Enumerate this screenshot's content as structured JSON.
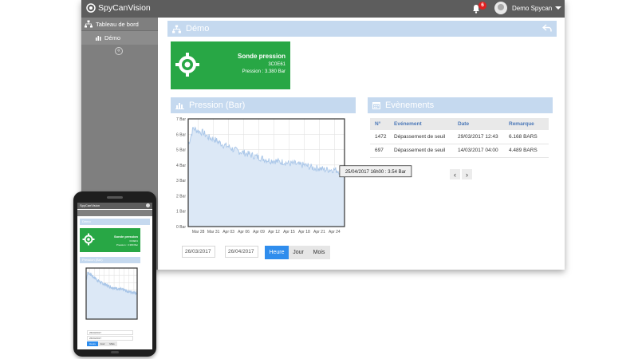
{
  "app": {
    "name": "SpyCanVision"
  },
  "topbar": {
    "notification_count": "6",
    "user_name": "Demo Spycan"
  },
  "sidebar": {
    "items": [
      {
        "label": "Tableau de bord"
      },
      {
        "label": "Démo"
      }
    ]
  },
  "page": {
    "title": "Démo"
  },
  "sensor": {
    "name": "Sonde pression",
    "id": "3C0E61",
    "pressure": "Pression : 3.380 Bar"
  },
  "pressure_panel": {
    "title": "Pression (Bar)"
  },
  "events_panel": {
    "title": "Evènements",
    "columns": [
      "N°",
      "Evénement",
      "Date",
      "Remarque"
    ],
    "rows": [
      [
        "1472",
        "Dépassement de seuil",
        "29/03/2017 12:43",
        "6.168 BARS"
      ],
      [
        "697",
        "Dépassement de seuil",
        "14/03/2017 04:00",
        "4.489 BARS"
      ]
    ]
  },
  "controls": {
    "date_from": "26/03/2017",
    "date_to": "26/04/2017",
    "buttons": [
      "Heure",
      "Jour",
      "Mois"
    ],
    "active": "Heure"
  },
  "colors": {
    "header_bg": "#5d5d5d",
    "sidebar_bg": "#7f7f7f",
    "panel_head": "#c5d9ef",
    "sensor_bg": "#28a745",
    "accent": "#2f8ded",
    "series": "#a9c6e8"
  },
  "chart_data": {
    "type": "area",
    "title": "",
    "xlabel": "",
    "ylabel": "",
    "x_ticks": [
      "Mar 28",
      "Mar 31",
      "Apr 03",
      "Apr 06",
      "Apr 09",
      "Apr 12",
      "Apr 15",
      "Apr 18",
      "Apr 21",
      "Apr 24"
    ],
    "y_ticks": [
      "0 Bar",
      "1 Bar",
      "2 Bar",
      "3 Bar",
      "4 Bar",
      "5 Bar",
      "6 Bar",
      "7 Bar"
    ],
    "ylim": [
      0,
      7
    ],
    "xlim": [
      "2017-03-26",
      "2017-04-26"
    ],
    "grid": true,
    "series": [
      {
        "x": [
          "2017-03-26",
          "2017-03-27",
          "2017-03-28",
          "2017-03-29",
          "2017-03-30",
          "2017-03-31",
          "2017-04-01",
          "2017-04-02",
          "2017-04-03",
          "2017-04-04",
          "2017-04-05",
          "2017-04-06",
          "2017-04-07",
          "2017-04-08",
          "2017-04-09",
          "2017-04-10",
          "2017-04-11",
          "2017-04-12",
          "2017-04-13",
          "2017-04-14",
          "2017-04-15",
          "2017-04-16",
          "2017-04-17",
          "2017-04-18",
          "2017-04-19",
          "2017-04-20",
          "2017-04-21",
          "2017-04-22",
          "2017-04-23",
          "2017-04-24",
          "2017-04-25",
          "2017-04-26"
        ],
        "values": [
          5.3,
          6.4,
          6.2,
          6.1,
          5.8,
          5.7,
          5.5,
          5.3,
          5.2,
          5.0,
          4.9,
          4.8,
          4.7,
          4.6,
          4.5,
          4.4,
          4.3,
          4.3,
          4.2,
          4.2,
          4.1,
          4.1,
          4.0,
          4.0,
          3.9,
          3.8,
          3.8,
          3.7,
          3.7,
          3.7,
          3.6,
          3.54
        ]
      }
    ],
    "tooltip": "25/04/2017 16h00 : 3.54 Bar"
  }
}
